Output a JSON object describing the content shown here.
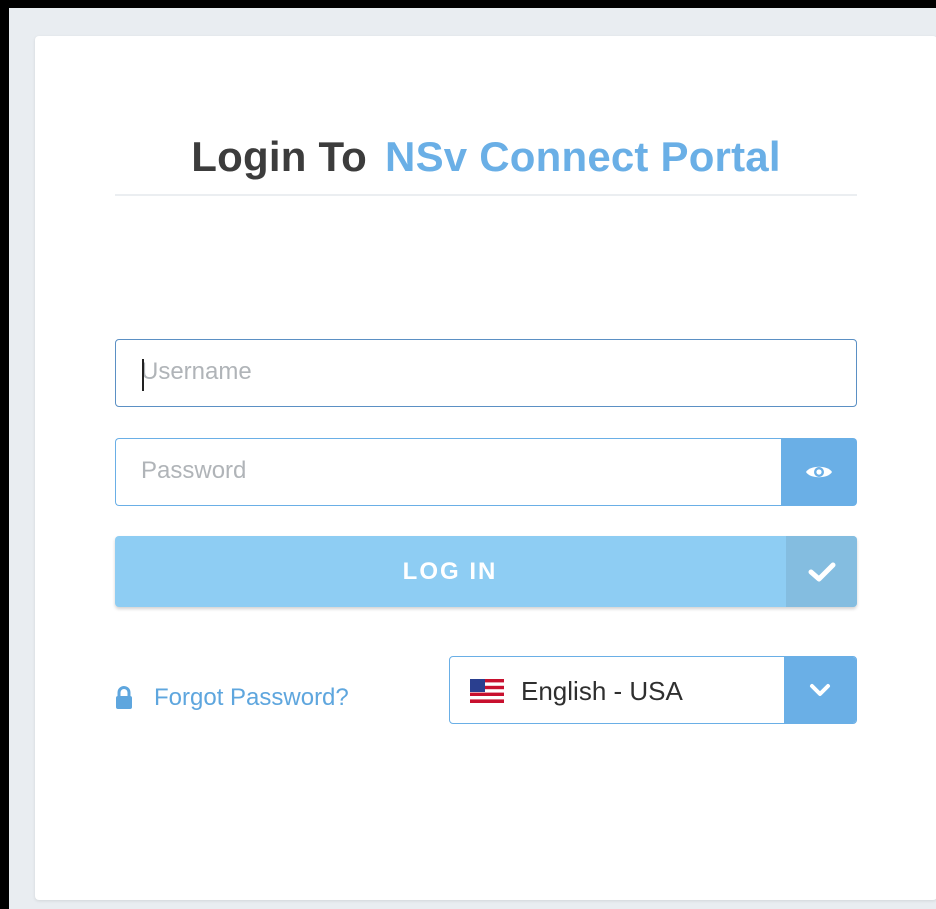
{
  "colors": {
    "accent": "#6aafe6",
    "login_button": "#8ecdf3",
    "title_dark": "#3c3c3c",
    "page_bg": "#e9edf1"
  },
  "title": {
    "prefix": "Login To",
    "highlight": "NSv Connect Portal"
  },
  "form": {
    "username": {
      "value": "",
      "placeholder": "Username"
    },
    "password": {
      "value": "",
      "placeholder": "Password",
      "toggle_icon": "eye-icon"
    },
    "login": {
      "label": "LOG IN",
      "icon": "check-icon"
    }
  },
  "footer": {
    "forgot_password": {
      "label": "Forgot Password?",
      "icon": "lock-icon"
    },
    "language": {
      "selected": "English - USA",
      "flag": "us-flag-icon",
      "dropdown_icon": "chevron-down-icon"
    }
  }
}
